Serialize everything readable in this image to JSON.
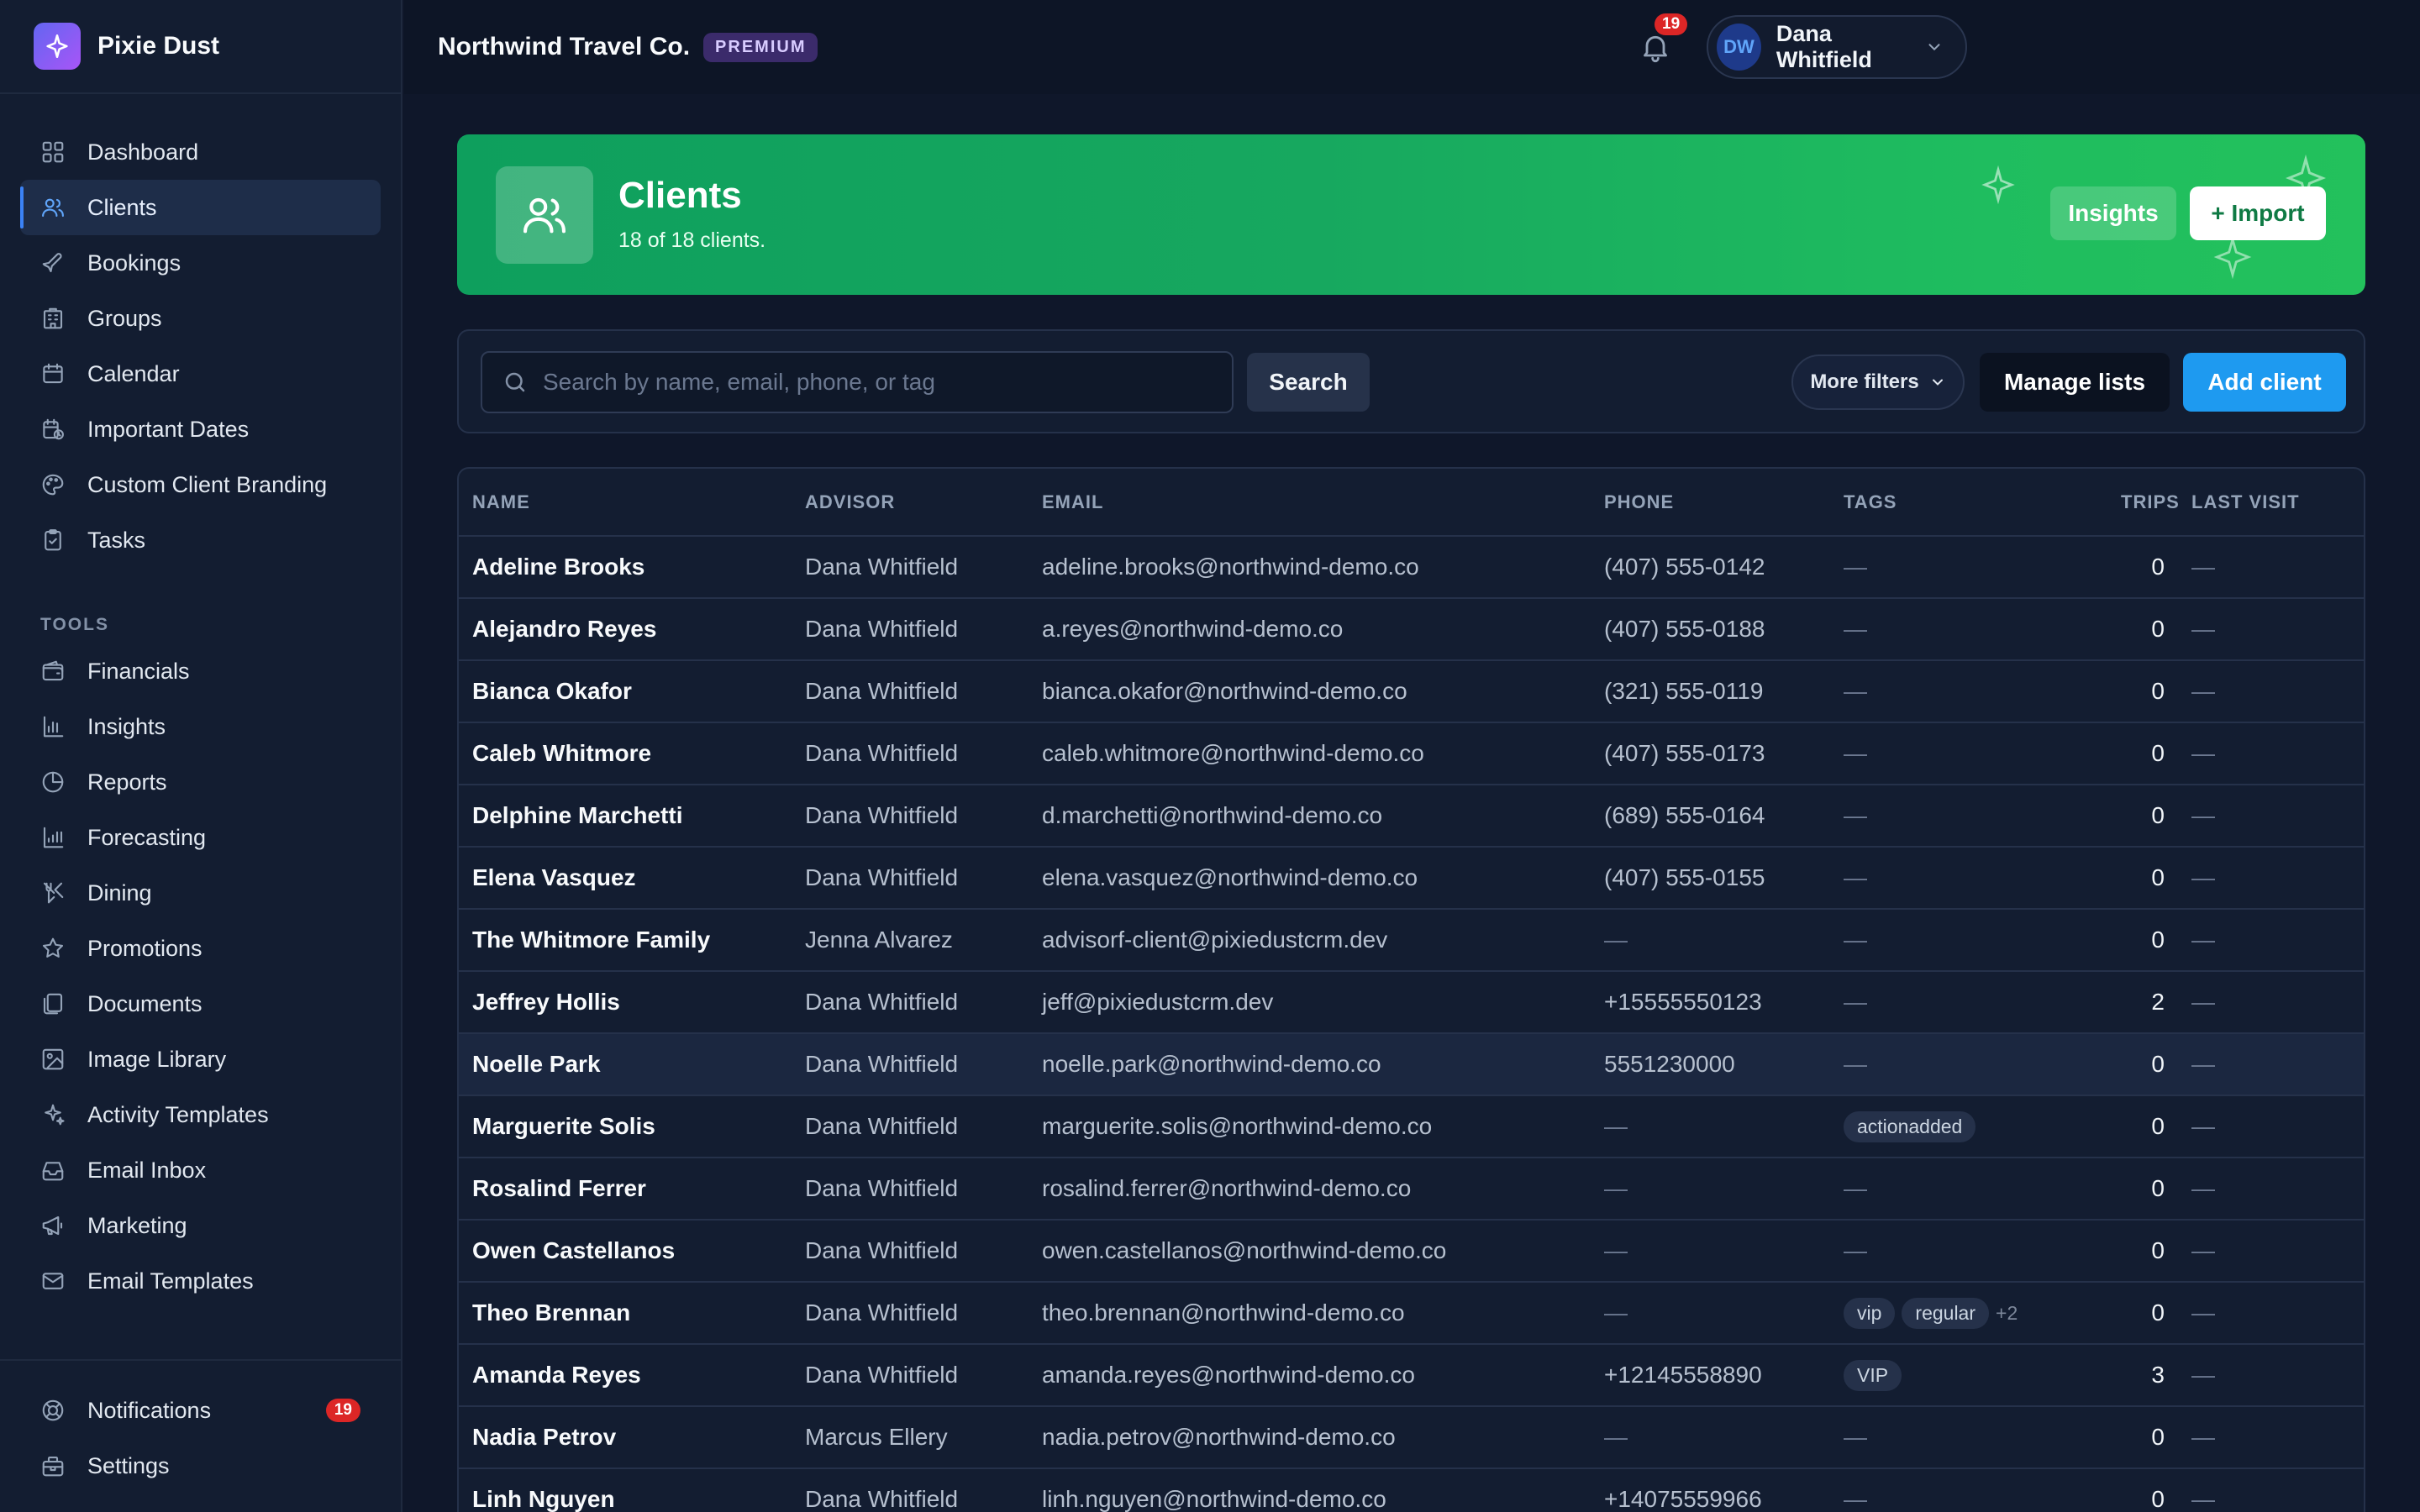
{
  "brand": {
    "name": "Pixie Dust",
    "icon": "sparkle-icon"
  },
  "sidebar": {
    "items": [
      {
        "label": "Dashboard",
        "icon": "dashboard-icon"
      },
      {
        "label": "Clients",
        "icon": "users-icon",
        "active": true
      },
      {
        "label": "Bookings",
        "icon": "plane-icon"
      },
      {
        "label": "Groups",
        "icon": "building-icon"
      },
      {
        "label": "Calendar",
        "icon": "calendar-icon"
      },
      {
        "label": "Important Dates",
        "icon": "calendar-clock-icon"
      },
      {
        "label": "Custom Client Branding",
        "icon": "palette-icon"
      },
      {
        "label": "Tasks",
        "icon": "clipboard-icon"
      }
    ],
    "tools_label": "TOOLS",
    "tools": [
      {
        "label": "Financials",
        "icon": "wallet-icon"
      },
      {
        "label": "Insights",
        "icon": "bar-chart-icon"
      },
      {
        "label": "Reports",
        "icon": "pie-chart-icon"
      },
      {
        "label": "Forecasting",
        "icon": "trend-chart-icon"
      },
      {
        "label": "Dining",
        "icon": "utensils-icon"
      },
      {
        "label": "Promotions",
        "icon": "star-icon"
      },
      {
        "label": "Documents",
        "icon": "documents-icon"
      },
      {
        "label": "Image Library",
        "icon": "image-icon"
      },
      {
        "label": "Activity Templates",
        "icon": "sparkles-icon"
      },
      {
        "label": "Email Inbox",
        "icon": "inbox-icon"
      },
      {
        "label": "Marketing",
        "icon": "megaphone-icon"
      },
      {
        "label": "Email Templates",
        "icon": "mail-icon"
      }
    ],
    "bottom": [
      {
        "label": "Notifications",
        "icon": "lifebuoy-icon",
        "badge": "19"
      },
      {
        "label": "Settings",
        "icon": "settings-icon"
      }
    ]
  },
  "topbar": {
    "org_name": "Northwind Travel Co.",
    "plan_badge": "PREMIUM",
    "notifications_count": "19",
    "user_initials": "DW",
    "user_name": "Dana Whitfield"
  },
  "hero": {
    "title": "Clients",
    "subtitle": "18 of 18 clients.",
    "insights_label": "Insights",
    "import_label": "+ Import"
  },
  "filters": {
    "search_placeholder": "Search by name, email, phone, or tag",
    "search_label": "Search",
    "more_filters_label": "More filters",
    "manage_lists_label": "Manage lists",
    "add_client_label": "Add client"
  },
  "table": {
    "columns": [
      "NAME",
      "ADVISOR",
      "EMAIL",
      "PHONE",
      "TAGS",
      "TRIPS",
      "LAST VISIT"
    ],
    "rows": [
      {
        "name": "Adeline Brooks",
        "advisor": "Dana Whitfield",
        "email": "adeline.brooks@northwind-demo.co",
        "phone": "(407) 555-0142",
        "tags": [],
        "more": "",
        "trips": "0",
        "last_visit": "—"
      },
      {
        "name": "Alejandro Reyes",
        "advisor": "Dana Whitfield",
        "email": "a.reyes@northwind-demo.co",
        "phone": "(407) 555-0188",
        "tags": [],
        "more": "",
        "trips": "0",
        "last_visit": "—"
      },
      {
        "name": "Bianca Okafor",
        "advisor": "Dana Whitfield",
        "email": "bianca.okafor@northwind-demo.co",
        "phone": "(321) 555-0119",
        "tags": [],
        "more": "",
        "trips": "0",
        "last_visit": "—"
      },
      {
        "name": "Caleb Whitmore",
        "advisor": "Dana Whitfield",
        "email": "caleb.whitmore@northwind-demo.co",
        "phone": "(407) 555-0173",
        "tags": [],
        "more": "",
        "trips": "0",
        "last_visit": "—"
      },
      {
        "name": "Delphine Marchetti",
        "advisor": "Dana Whitfield",
        "email": "d.marchetti@northwind-demo.co",
        "phone": "(689) 555-0164",
        "tags": [],
        "more": "",
        "trips": "0",
        "last_visit": "—"
      },
      {
        "name": "Elena Vasquez",
        "advisor": "Dana Whitfield",
        "email": "elena.vasquez@northwind-demo.co",
        "phone": "(407) 555-0155",
        "tags": [],
        "more": "",
        "trips": "0",
        "last_visit": "—"
      },
      {
        "name": "The Whitmore Family",
        "advisor": "Jenna Alvarez",
        "email": "advisorf-client@pixiedustcrm.dev",
        "phone": "—",
        "tags": [],
        "more": "",
        "trips": "0",
        "last_visit": "—"
      },
      {
        "name": "Jeffrey Hollis",
        "advisor": "Dana Whitfield",
        "email": "jeff@pixiedustcrm.dev",
        "phone": "+15555550123",
        "tags": [],
        "more": "",
        "trips": "2",
        "last_visit": "—"
      },
      {
        "name": "Noelle Park",
        "advisor": "Dana Whitfield",
        "email": "noelle.park@northwind-demo.co",
        "phone": "5551230000",
        "tags": [],
        "more": "",
        "trips": "0",
        "last_visit": "—",
        "highlight": true
      },
      {
        "name": "Marguerite Solis",
        "advisor": "Dana Whitfield",
        "email": "marguerite.solis@northwind-demo.co",
        "phone": "—",
        "tags": [
          "actionadded"
        ],
        "more": "",
        "trips": "0",
        "last_visit": "—"
      },
      {
        "name": "Rosalind Ferrer",
        "advisor": "Dana Whitfield",
        "email": "rosalind.ferrer@northwind-demo.co",
        "phone": "—",
        "tags": [],
        "more": "",
        "trips": "0",
        "last_visit": "—"
      },
      {
        "name": "Owen Castellanos",
        "advisor": "Dana Whitfield",
        "email": "owen.castellanos@northwind-demo.co",
        "phone": "—",
        "tags": [],
        "more": "",
        "trips": "0",
        "last_visit": "—"
      },
      {
        "name": "Theo Brennan",
        "advisor": "Dana Whitfield",
        "email": "theo.brennan@northwind-demo.co",
        "phone": "—",
        "tags": [
          "vip",
          "regular"
        ],
        "more": "+2",
        "trips": "0",
        "last_visit": "—"
      },
      {
        "name": "Amanda Reyes",
        "advisor": "Dana Whitfield",
        "email": "amanda.reyes@northwind-demo.co",
        "phone": "+12145558890",
        "tags": [
          "VIP"
        ],
        "more": "",
        "trips": "3",
        "last_visit": "—"
      },
      {
        "name": "Nadia Petrov",
        "advisor": "Marcus Ellery",
        "email": "nadia.petrov@northwind-demo.co",
        "phone": "—",
        "tags": [],
        "more": "",
        "trips": "0",
        "last_visit": "—"
      },
      {
        "name": "Linh Nguyen",
        "advisor": "Dana Whitfield",
        "email": "linh.nguyen@northwind-demo.co",
        "phone": "+14075559966",
        "tags": [],
        "more": "",
        "trips": "0",
        "last_visit": "—"
      }
    ],
    "empty_value": "—"
  },
  "colors": {
    "accent": "#1e9af0",
    "hero_green": "#17a85f",
    "badge_red": "#dc2626",
    "premium": "#3b2b6b"
  }
}
